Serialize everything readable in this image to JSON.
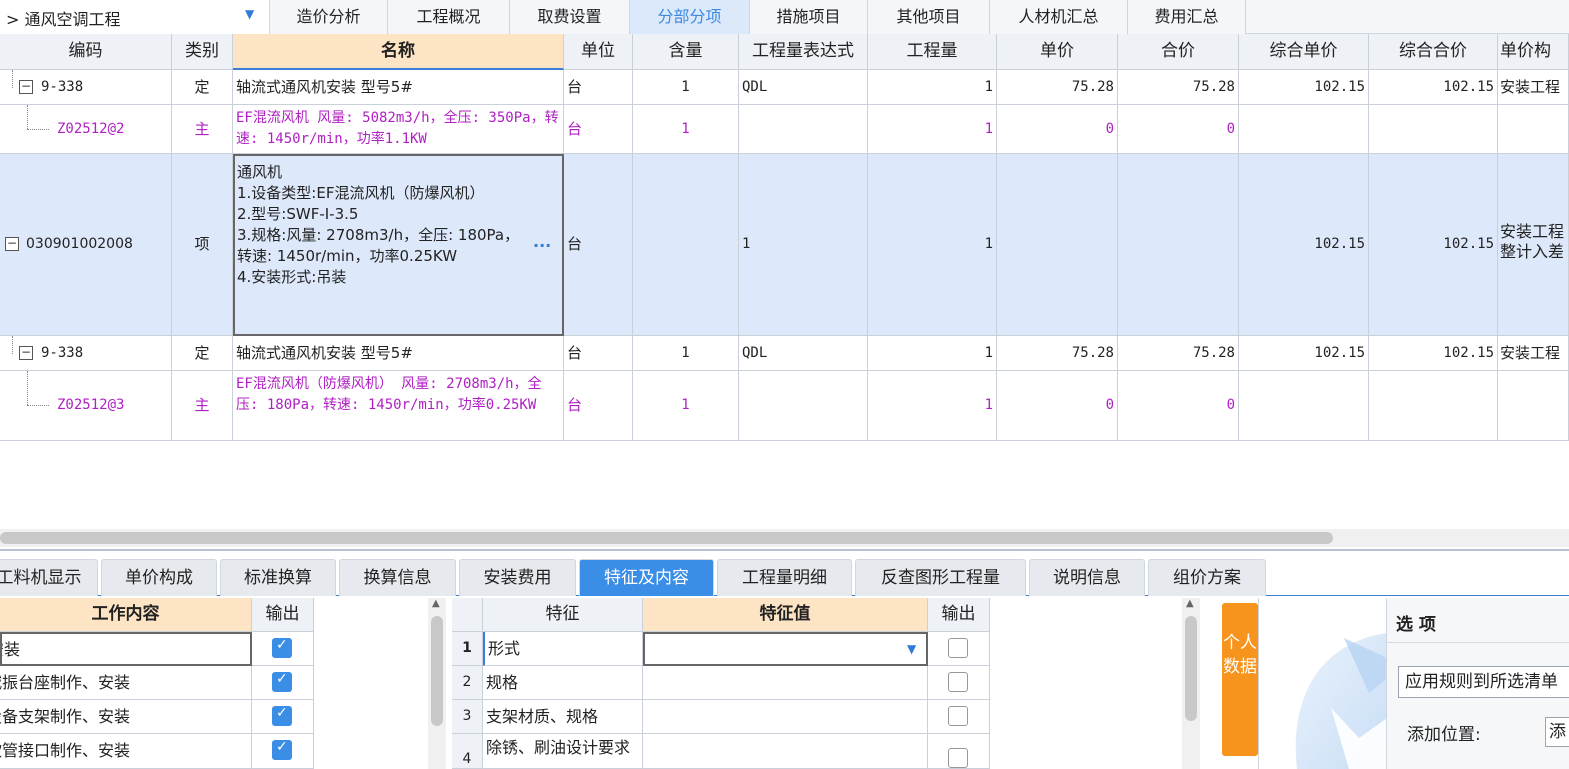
{
  "toolbar": {
    "project": "> 通风空调工程",
    "tabs": [
      "造价分析",
      "工程概况",
      "取费设置",
      "分部分项",
      "措施项目",
      "其他项目",
      "人材机汇总",
      "费用汇总"
    ],
    "active_tab": "分部分项"
  },
  "grid": {
    "headers": [
      "编码",
      "类别",
      "名称",
      "单位",
      "含量",
      "工程量表达式",
      "工程量",
      "单价",
      "合价",
      "综合单价",
      "综合合价",
      "单价构"
    ],
    "rows": [
      {
        "code": "9-338",
        "type": "定",
        "name": "轴流式通风机安装 型号5#",
        "unit": "台",
        "qty_ratio": "1",
        "expr": "QDL",
        "qty": "1",
        "price": "75.28",
        "total": "75.28",
        "comp_price": "102.15",
        "comp_total": "102.15",
        "struct": "安装工程"
      },
      {
        "code": "Z02512@2",
        "type": "主",
        "name": "EF混流风机 风量: 5082m3/h，全压: 350Pa，转速: 1450r/min，功率1.1KW",
        "unit": "台",
        "qty_ratio": "1",
        "expr": "",
        "qty": "1",
        "price": "0",
        "total": "0",
        "comp_price": "",
        "comp_total": "",
        "struct": ""
      },
      {
        "code": "030901002008",
        "type": "项",
        "name": "通风机\n1.设备类型:EF混流风机（防爆风机）\n2.型号:SWF-Ⅰ-3.5\n3.规格:风量: 2708m3/h，全压: 180Pa，转速: 1450r/min，功率0.25KW\n4.安装形式:吊装",
        "unit": "台",
        "qty_ratio": "",
        "expr": "1",
        "qty": "1",
        "price": "",
        "total": "",
        "comp_price": "102.15",
        "comp_total": "102.15",
        "struct": "安装工程整计入差"
      },
      {
        "code": "9-338",
        "type": "定",
        "name": "轴流式通风机安装 型号5#",
        "unit": "台",
        "qty_ratio": "1",
        "expr": "QDL",
        "qty": "1",
        "price": "75.28",
        "total": "75.28",
        "comp_price": "102.15",
        "comp_total": "102.15",
        "struct": "安装工程"
      },
      {
        "code": "Z02512@3",
        "type": "主",
        "name": "EF混流风机（防爆风机） 风量: 2708m3/h，全压: 180Pa，转速: 1450r/min，功率0.25KW",
        "unit": "台",
        "qty_ratio": "1",
        "expr": "",
        "qty": "1",
        "price": "0",
        "total": "0",
        "comp_price": "",
        "comp_total": "",
        "struct": ""
      }
    ],
    "ellipsis": "···",
    "tree_minus": "−"
  },
  "bottom_tabs": {
    "items": [
      "工料机显示",
      "单价构成",
      "标准换算",
      "换算信息",
      "安装费用",
      "特征及内容",
      "工程量明细",
      "反查图形工程量",
      "说明信息",
      "组价方案"
    ],
    "active": "特征及内容"
  },
  "work_content": {
    "headers": [
      "工作内容",
      "输出"
    ],
    "rows": [
      {
        "text": "安装",
        "checked": true
      },
      {
        "text": "减振台座制作、安装",
        "checked": true
      },
      {
        "text": "设备支架制作、安装",
        "checked": true
      },
      {
        "text": "软管接口制作、安装",
        "checked": true
      }
    ]
  },
  "features": {
    "headers": [
      "",
      "特征",
      "特征值",
      "输出"
    ],
    "rows": [
      {
        "no": "1",
        "name": "形式",
        "value": "",
        "checked": false
      },
      {
        "no": "2",
        "name": "规格",
        "value": "",
        "checked": false
      },
      {
        "no": "3",
        "name": "支架材质、规格",
        "value": "",
        "checked": false
      },
      {
        "no": "4",
        "name": "除锈、刷油设计要求",
        "value": "",
        "checked": false
      }
    ]
  },
  "side": {
    "personal_data": "个人数据",
    "options_title": "选 项",
    "rule_button": "应用规则到所选清单",
    "add_position_label": "添加位置:",
    "add_position_value": "添"
  },
  "colors": {
    "accent": "#3a8ee6",
    "header_highlight": "#fde4c4",
    "selected_row": "#dde9fb",
    "main_material": "#b01fc4",
    "orange": "#f7941d"
  }
}
